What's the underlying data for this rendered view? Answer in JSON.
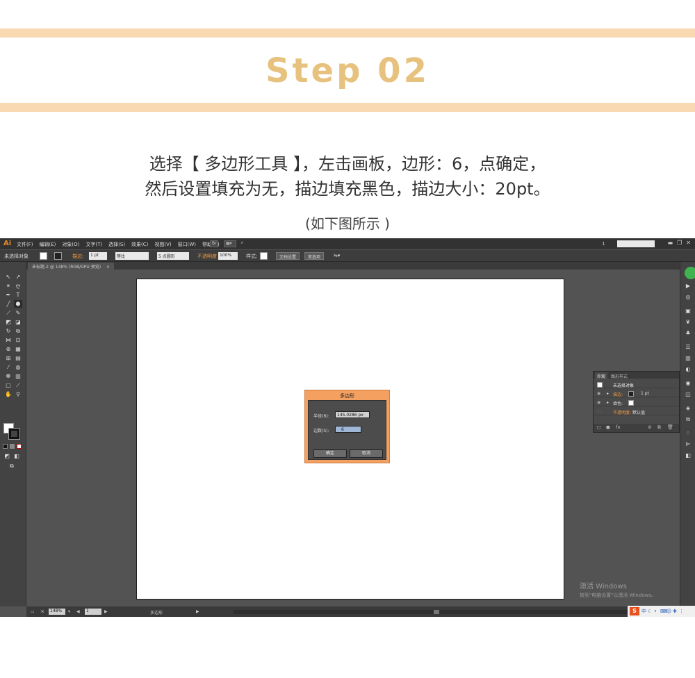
{
  "header": {
    "step_title": "Step 02",
    "instruction_line1": "选择【 多边形工具 】，左击画板，边形：6，点确定，",
    "instruction_line2": "然后设置填充为无，描边填充黑色，描边大小：20pt。",
    "note": "(如下图所示 )"
  },
  "menubar": {
    "logo": "Ai",
    "items": [
      "文件(F)",
      "编辑(E)",
      "对象(O)",
      "文字(T)",
      "选择(S)",
      "效果(C)",
      "视图(V)",
      "窗口(W)",
      "帮助(H)"
    ],
    "workspace_count": "1"
  },
  "control_bar": {
    "selection_label": "未选择对象",
    "stroke_label": "描边:",
    "stroke_width": "1 pt",
    "stroke_profile": "等比",
    "brush_label": "5 点圆形",
    "opacity_label": "不透明度",
    "opacity_value": "100%",
    "style_label": "样式:",
    "doc_setup_button": "文档设置",
    "prefs_button": "首选项"
  },
  "document_tab": {
    "title": "未标题-2 @ 148% (RGB/GPU 预览)",
    "close": "×"
  },
  "dialog": {
    "title": "多边形",
    "radius_label": "半径(R):",
    "radius_value": "145.0286 px",
    "sides_label": "边数(S):",
    "sides_value": "6",
    "ok_button": "确定",
    "cancel_button": "取消"
  },
  "appearance_panel": {
    "tab_appearance": "外观",
    "tab_graphic_styles": "图形样式",
    "header_row": "未选择对象",
    "stroke_row_label": "描边:",
    "stroke_row_value": "1 pt",
    "fill_row_label": "填色:",
    "opacity_row_label": "不透明度:",
    "opacity_row_value": "默认值"
  },
  "status_bar": {
    "zoom": "148%",
    "artboard_num": "1",
    "tool_name": "多边形"
  },
  "watermark": {
    "line1": "激活 Windows",
    "line2": "转到\"电脑设置\"以激活 Windows。"
  },
  "tray": {
    "ime": "S",
    "ime_mode": "中"
  },
  "colors": {
    "band": "#f8d9b2",
    "step_title": "#e7c17e",
    "dialog_orange": "#f3a060",
    "app_bg": "#535353"
  }
}
